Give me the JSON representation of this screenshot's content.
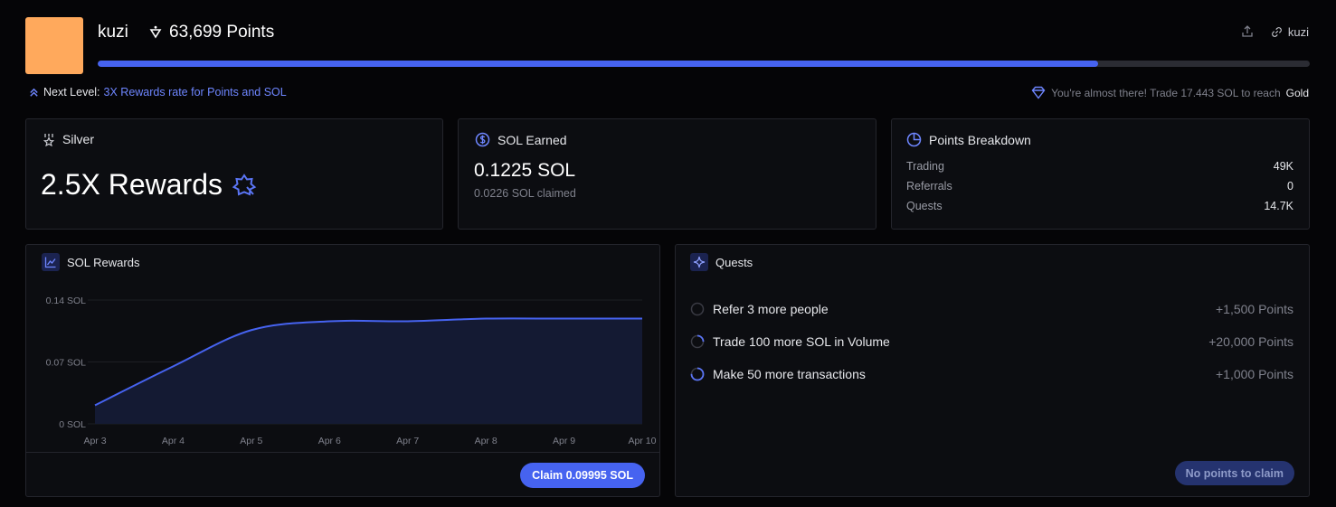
{
  "profile": {
    "username": "kuzi",
    "points": "63,699 Points",
    "avatar_color": "#ffa95c",
    "link_label": "kuzi",
    "progress_fraction": 0.825
  },
  "level": {
    "next_prefix": "Next Level:",
    "next_reward": "3X Rewards rate for Points and SOL",
    "almost_text": "You're almost there! Trade 17.443 SOL to reach",
    "almost_target": "Gold"
  },
  "tier": {
    "name": "Silver",
    "rewards": "2.5X Rewards"
  },
  "sol": {
    "title": "SOL Earned",
    "earned": "0.1225 SOL",
    "claimed": "0.0226 SOL claimed"
  },
  "breakdown": {
    "title": "Points Breakdown",
    "rows": [
      {
        "label": "Trading",
        "value": "49K"
      },
      {
        "label": "Referrals",
        "value": "0"
      },
      {
        "label": "Quests",
        "value": "14.7K"
      }
    ]
  },
  "rewards_chart": {
    "title": "SOL Rewards",
    "claim_label": "Claim 0.09995 SOL"
  },
  "chart_data": {
    "type": "area",
    "x": [
      "Apr 3",
      "Apr 4",
      "Apr 5",
      "Apr 6",
      "Apr 7",
      "Apr 8",
      "Apr 9",
      "Apr 10"
    ],
    "series": [
      {
        "values": [
          0.021,
          0.065,
          0.106,
          0.116,
          0.116,
          0.119,
          0.119,
          0.119
        ]
      }
    ],
    "y_ticks": [
      "0 SOL",
      "0.07 SOL",
      "0.14 SOL"
    ],
    "ylim": [
      0,
      0.14
    ],
    "grid": true,
    "colors": {
      "line": "#4663f0",
      "fill": "#141a33"
    }
  },
  "quests": {
    "title": "Quests",
    "items": [
      {
        "label": "Refer 3 more people",
        "reward": "+1,500 Points",
        "progress": 0
      },
      {
        "label": "Trade 100 more SOL in Volume",
        "reward": "+20,000 Points",
        "progress": 0.25
      },
      {
        "label": "Make 50 more transactions",
        "reward": "+1,000 Points",
        "progress": 0.75
      }
    ],
    "empty_button": "No points to claim"
  },
  "icons": {
    "points": "points-icon",
    "share": "share-icon",
    "link": "link-icon",
    "chevrons": "chevrons-up-icon",
    "diamond": "diamond-icon",
    "medal": "medal-icon",
    "coin": "coin-icon",
    "pie": "pie-chart-icon",
    "chart": "line-chart-icon",
    "sparkle": "sparkle-icon",
    "badge": "badge-star-icon"
  }
}
